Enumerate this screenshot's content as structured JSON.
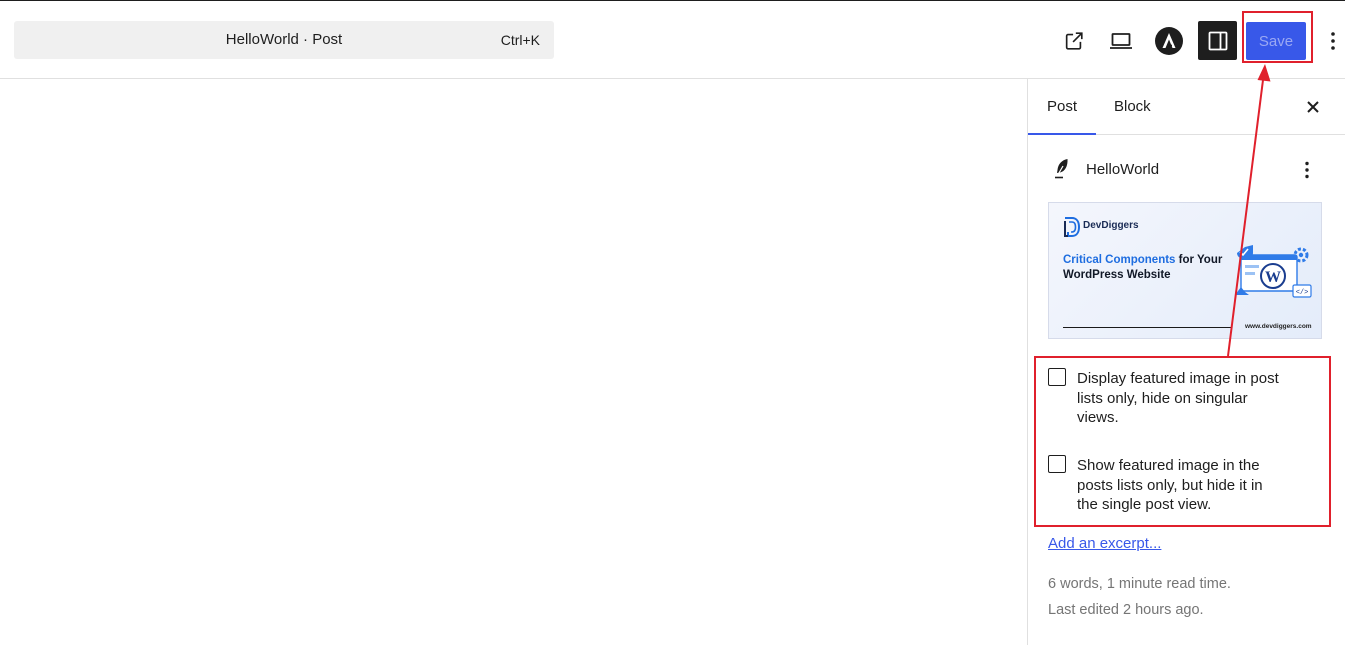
{
  "header": {
    "command_title": "HelloWorld · Post",
    "command_shortcut": "Ctrl+K",
    "save_label": "Save",
    "icons": [
      "external-link-icon",
      "desktop-preview-icon",
      "astra-logo-icon",
      "sidebar-toggle-icon",
      "more-vertical-icon"
    ]
  },
  "sidebar": {
    "tabs": [
      {
        "label": "Post",
        "active": true
      },
      {
        "label": "Block",
        "active": false
      }
    ],
    "post_title": "HelloWorld",
    "featured_image": {
      "brand": "DevDiggers",
      "headline_highlight": "Critical Components",
      "headline_rest": " for Your WordPress Website",
      "url": "www.devdiggers.com"
    },
    "checkboxes": [
      {
        "label": "Display featured image in post lists only, hide on singular views.",
        "checked": false
      },
      {
        "label": "Show featured image in the posts lists only, but hide it in the single post view.",
        "checked": false
      }
    ],
    "excerpt_link": "Add an excerpt...",
    "stats": "6 words, 1 minute read time.",
    "last_edited": "Last edited 2 hours ago."
  },
  "colors": {
    "accent": "#3858e9",
    "annotation": "#e0202c",
    "text": "#1e1e1e",
    "muted": "#757575"
  }
}
